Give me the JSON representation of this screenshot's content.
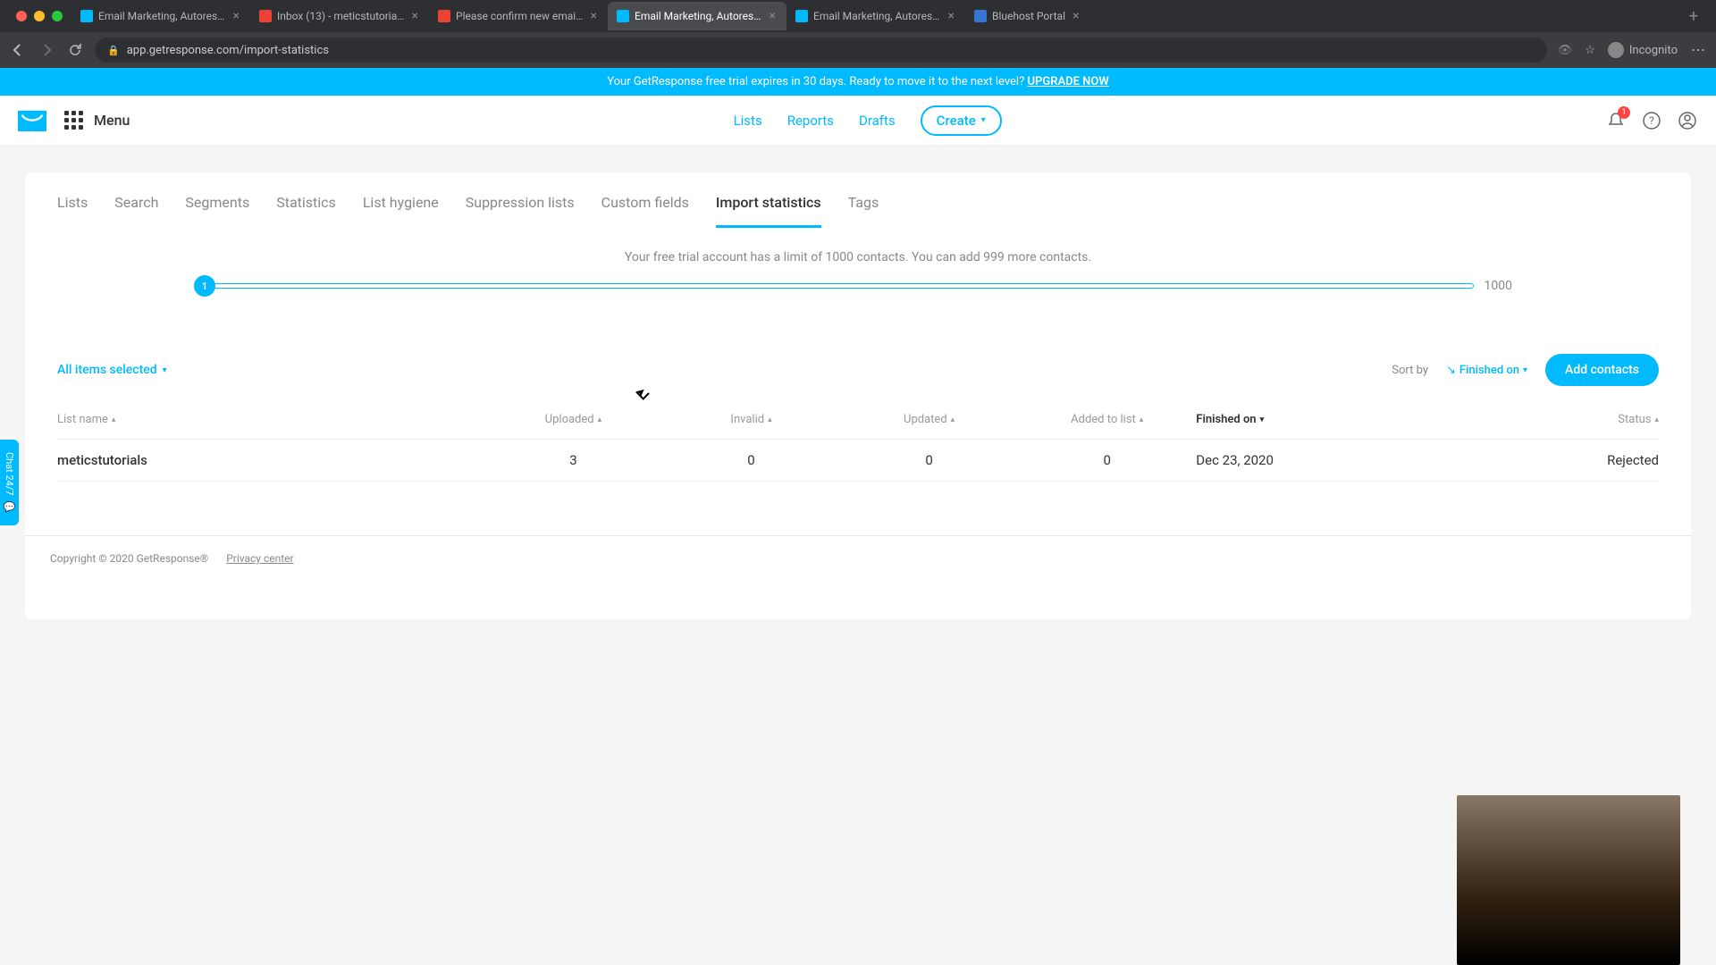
{
  "browser": {
    "tabs": [
      {
        "title": "Email Marketing, Autoresponde",
        "favicon": "gr",
        "active": false
      },
      {
        "title": "Inbox (13) - meticstutorials@g",
        "favicon": "gm",
        "active": false
      },
      {
        "title": "Please confirm new email addr",
        "favicon": "gm",
        "active": false
      },
      {
        "title": "Email Marketing, Autoresponde",
        "favicon": "gr",
        "active": true
      },
      {
        "title": "Email Marketing, Autoresponde",
        "favicon": "gr",
        "active": false
      },
      {
        "title": "Bluehost Portal",
        "favicon": "bh",
        "active": false
      }
    ],
    "url": "app.getresponse.com/import-statistics",
    "incognito_label": "Incognito"
  },
  "banner": {
    "text": "Your GetResponse free trial expires in 30 days. Ready to move it to the next level? ",
    "link": "UPGRADE NOW"
  },
  "nav": {
    "menu": "Menu",
    "links": {
      "lists": "Lists",
      "reports": "Reports",
      "drafts": "Drafts"
    },
    "create": "Create",
    "notification_count": "1"
  },
  "subtabs": {
    "lists": "Lists",
    "search": "Search",
    "segments": "Segments",
    "statistics": "Statistics",
    "hygiene": "List hygiene",
    "suppression": "Suppression lists",
    "custom": "Custom fields",
    "import": "Import statistics",
    "tags": "Tags"
  },
  "limit": {
    "text": "Your free trial account has a limit of 1000 contacts. You can add 999 more contacts.",
    "current": "1",
    "max": "1000"
  },
  "toolbar": {
    "select_all": "All items selected",
    "sort_label": "Sort by",
    "sort_value": "Finished on",
    "add": "Add contacts"
  },
  "table": {
    "headers": {
      "name": "List name",
      "uploaded": "Uploaded",
      "invalid": "Invalid",
      "updated": "Updated",
      "added": "Added to list",
      "finished": "Finished on",
      "status": "Status"
    },
    "rows": [
      {
        "name": "meticstutorials",
        "uploaded": "3",
        "invalid": "0",
        "updated": "0",
        "added": "0",
        "finished": "Dec 23, 2020",
        "status": "Rejected"
      }
    ]
  },
  "footer": {
    "copyright": "Copyright © 2020 GetResponse®",
    "privacy": "Privacy center"
  },
  "chat": "Chat 24/7"
}
